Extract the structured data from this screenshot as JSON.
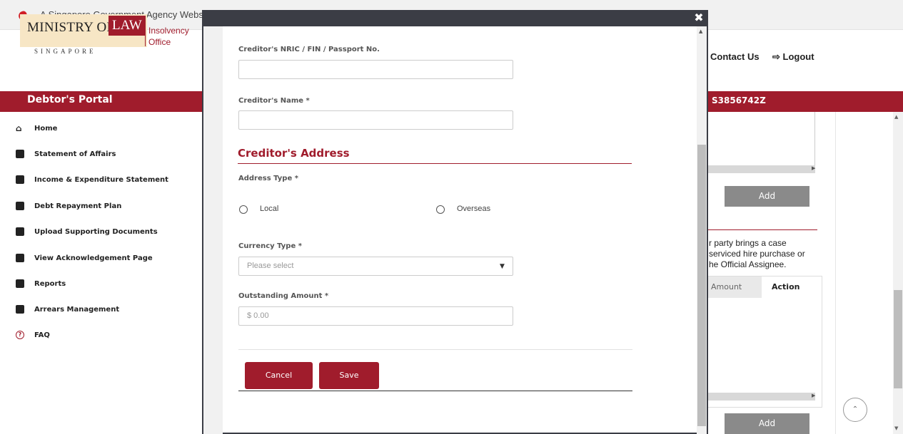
{
  "gov_banner": {
    "text": "A Singapore Government Agency Websit"
  },
  "logo": {
    "ministry": "MINISTRY OF",
    "law": "LAW",
    "unit_line1": "Insolvency",
    "unit_line2": "Office",
    "country": "SINGAPORE"
  },
  "header": {
    "contact_label": "Contact Us",
    "logout_label": "⇨ Logout",
    "portal_title": "Debtor's Portal",
    "user_id": "S3856742Z"
  },
  "sidebar": {
    "items": [
      {
        "label": "Home",
        "icon": "home-icon"
      },
      {
        "label": "Statement of Affairs",
        "icon": "document-icon"
      },
      {
        "label": "Income & Expenditure Statement",
        "icon": "statement-icon"
      },
      {
        "label": "Debt Repayment Plan",
        "icon": "plan-icon"
      },
      {
        "label": "Upload Supporting Documents",
        "icon": "upload-icon"
      },
      {
        "label": "View Acknowledgement Page",
        "icon": "acknowledgement-icon"
      },
      {
        "label": "Reports",
        "icon": "reports-icon"
      },
      {
        "label": "Arrears Management",
        "icon": "arrears-icon"
      },
      {
        "label": "FAQ",
        "icon": "faq-icon"
      }
    ]
  },
  "background_panel": {
    "add_label": "Add",
    "case_text_line1": "r party brings a case",
    "case_text_line2": "serviced hire purchase or",
    "case_text_line3": "he Official Assignee.",
    "col_amount": "Amount",
    "col_action": "Action"
  },
  "modal": {
    "close_label": "✖",
    "nric_label": "Creditor's NRIC / FIN / Passport No.",
    "nric_value": "",
    "name_label": "Creditor's Name *",
    "name_value": "",
    "address_section": "Creditor's Address",
    "address_type_label": "Address Type *",
    "address_options": [
      "Local",
      "Overseas"
    ],
    "currency_label": "Currency Type *",
    "currency_placeholder": "Please select",
    "amount_label": "Outstanding Amount *",
    "amount_placeholder": "$ 0.00",
    "cancel_label": "Cancel",
    "save_label": "Save"
  },
  "colors": {
    "brand_red": "#a01c2c",
    "modal_bar": "#3b3d45",
    "button_gray": "#8a8a8a"
  }
}
